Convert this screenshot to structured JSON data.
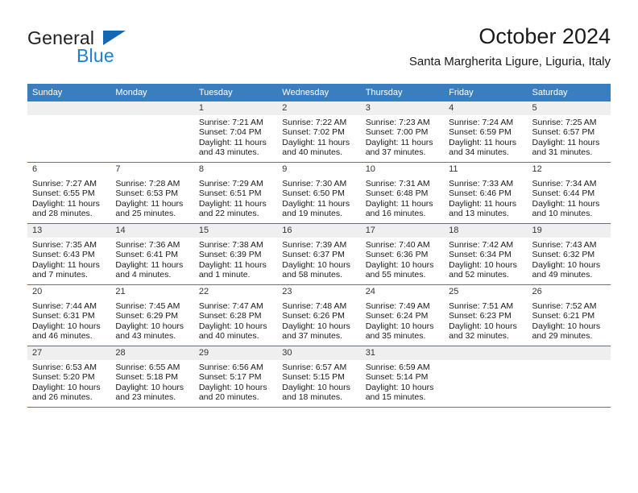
{
  "logo": {
    "text_primary": "General",
    "text_secondary": "Blue",
    "triangle_color": "#1468b3",
    "secondary_color": "#1f7fd4"
  },
  "header": {
    "title": "October 2024",
    "subtitle": "Santa Margherita Ligure, Liguria, Italy"
  },
  "theme": {
    "header_row_bg": "#3a7ebf",
    "header_row_text": "#ffffff",
    "daynum_bg": "#efefef",
    "grid_line": "#3a7ebf"
  },
  "weekdays": [
    "Sunday",
    "Monday",
    "Tuesday",
    "Wednesday",
    "Thursday",
    "Friday",
    "Saturday"
  ],
  "labels": {
    "sunrise_prefix": "Sunrise:",
    "sunset_prefix": "Sunset:",
    "daylight_prefix": "Daylight:"
  },
  "weeks": [
    [
      {
        "empty": true
      },
      {
        "empty": true
      },
      {
        "day": "1",
        "sunrise": "Sunrise: 7:21 AM",
        "sunset": "Sunset: 7:04 PM",
        "daylight_line1": "Daylight: 11 hours",
        "daylight_line2": "and 43 minutes."
      },
      {
        "day": "2",
        "sunrise": "Sunrise: 7:22 AM",
        "sunset": "Sunset: 7:02 PM",
        "daylight_line1": "Daylight: 11 hours",
        "daylight_line2": "and 40 minutes."
      },
      {
        "day": "3",
        "sunrise": "Sunrise: 7:23 AM",
        "sunset": "Sunset: 7:00 PM",
        "daylight_line1": "Daylight: 11 hours",
        "daylight_line2": "and 37 minutes."
      },
      {
        "day": "4",
        "sunrise": "Sunrise: 7:24 AM",
        "sunset": "Sunset: 6:59 PM",
        "daylight_line1": "Daylight: 11 hours",
        "daylight_line2": "and 34 minutes."
      },
      {
        "day": "5",
        "sunrise": "Sunrise: 7:25 AM",
        "sunset": "Sunset: 6:57 PM",
        "daylight_line1": "Daylight: 11 hours",
        "daylight_line2": "and 31 minutes."
      }
    ],
    [
      {
        "day": "6",
        "sunrise": "Sunrise: 7:27 AM",
        "sunset": "Sunset: 6:55 PM",
        "daylight_line1": "Daylight: 11 hours",
        "daylight_line2": "and 28 minutes."
      },
      {
        "day": "7",
        "sunrise": "Sunrise: 7:28 AM",
        "sunset": "Sunset: 6:53 PM",
        "daylight_line1": "Daylight: 11 hours",
        "daylight_line2": "and 25 minutes."
      },
      {
        "day": "8",
        "sunrise": "Sunrise: 7:29 AM",
        "sunset": "Sunset: 6:51 PM",
        "daylight_line1": "Daylight: 11 hours",
        "daylight_line2": "and 22 minutes."
      },
      {
        "day": "9",
        "sunrise": "Sunrise: 7:30 AM",
        "sunset": "Sunset: 6:50 PM",
        "daylight_line1": "Daylight: 11 hours",
        "daylight_line2": "and 19 minutes."
      },
      {
        "day": "10",
        "sunrise": "Sunrise: 7:31 AM",
        "sunset": "Sunset: 6:48 PM",
        "daylight_line1": "Daylight: 11 hours",
        "daylight_line2": "and 16 minutes."
      },
      {
        "day": "11",
        "sunrise": "Sunrise: 7:33 AM",
        "sunset": "Sunset: 6:46 PM",
        "daylight_line1": "Daylight: 11 hours",
        "daylight_line2": "and 13 minutes."
      },
      {
        "day": "12",
        "sunrise": "Sunrise: 7:34 AM",
        "sunset": "Sunset: 6:44 PM",
        "daylight_line1": "Daylight: 11 hours",
        "daylight_line2": "and 10 minutes."
      }
    ],
    [
      {
        "day": "13",
        "sunrise": "Sunrise: 7:35 AM",
        "sunset": "Sunset: 6:43 PM",
        "daylight_line1": "Daylight: 11 hours",
        "daylight_line2": "and 7 minutes."
      },
      {
        "day": "14",
        "sunrise": "Sunrise: 7:36 AM",
        "sunset": "Sunset: 6:41 PM",
        "daylight_line1": "Daylight: 11 hours",
        "daylight_line2": "and 4 minutes."
      },
      {
        "day": "15",
        "sunrise": "Sunrise: 7:38 AM",
        "sunset": "Sunset: 6:39 PM",
        "daylight_line1": "Daylight: 11 hours",
        "daylight_line2": "and 1 minute."
      },
      {
        "day": "16",
        "sunrise": "Sunrise: 7:39 AM",
        "sunset": "Sunset: 6:37 PM",
        "daylight_line1": "Daylight: 10 hours",
        "daylight_line2": "and 58 minutes."
      },
      {
        "day": "17",
        "sunrise": "Sunrise: 7:40 AM",
        "sunset": "Sunset: 6:36 PM",
        "daylight_line1": "Daylight: 10 hours",
        "daylight_line2": "and 55 minutes."
      },
      {
        "day": "18",
        "sunrise": "Sunrise: 7:42 AM",
        "sunset": "Sunset: 6:34 PM",
        "daylight_line1": "Daylight: 10 hours",
        "daylight_line2": "and 52 minutes."
      },
      {
        "day": "19",
        "sunrise": "Sunrise: 7:43 AM",
        "sunset": "Sunset: 6:32 PM",
        "daylight_line1": "Daylight: 10 hours",
        "daylight_line2": "and 49 minutes."
      }
    ],
    [
      {
        "day": "20",
        "sunrise": "Sunrise: 7:44 AM",
        "sunset": "Sunset: 6:31 PM",
        "daylight_line1": "Daylight: 10 hours",
        "daylight_line2": "and 46 minutes."
      },
      {
        "day": "21",
        "sunrise": "Sunrise: 7:45 AM",
        "sunset": "Sunset: 6:29 PM",
        "daylight_line1": "Daylight: 10 hours",
        "daylight_line2": "and 43 minutes."
      },
      {
        "day": "22",
        "sunrise": "Sunrise: 7:47 AM",
        "sunset": "Sunset: 6:28 PM",
        "daylight_line1": "Daylight: 10 hours",
        "daylight_line2": "and 40 minutes."
      },
      {
        "day": "23",
        "sunrise": "Sunrise: 7:48 AM",
        "sunset": "Sunset: 6:26 PM",
        "daylight_line1": "Daylight: 10 hours",
        "daylight_line2": "and 37 minutes."
      },
      {
        "day": "24",
        "sunrise": "Sunrise: 7:49 AM",
        "sunset": "Sunset: 6:24 PM",
        "daylight_line1": "Daylight: 10 hours",
        "daylight_line2": "and 35 minutes."
      },
      {
        "day": "25",
        "sunrise": "Sunrise: 7:51 AM",
        "sunset": "Sunset: 6:23 PM",
        "daylight_line1": "Daylight: 10 hours",
        "daylight_line2": "and 32 minutes."
      },
      {
        "day": "26",
        "sunrise": "Sunrise: 7:52 AM",
        "sunset": "Sunset: 6:21 PM",
        "daylight_line1": "Daylight: 10 hours",
        "daylight_line2": "and 29 minutes."
      }
    ],
    [
      {
        "day": "27",
        "sunrise": "Sunrise: 6:53 AM",
        "sunset": "Sunset: 5:20 PM",
        "daylight_line1": "Daylight: 10 hours",
        "daylight_line2": "and 26 minutes."
      },
      {
        "day": "28",
        "sunrise": "Sunrise: 6:55 AM",
        "sunset": "Sunset: 5:18 PM",
        "daylight_line1": "Daylight: 10 hours",
        "daylight_line2": "and 23 minutes."
      },
      {
        "day": "29",
        "sunrise": "Sunrise: 6:56 AM",
        "sunset": "Sunset: 5:17 PM",
        "daylight_line1": "Daylight: 10 hours",
        "daylight_line2": "and 20 minutes."
      },
      {
        "day": "30",
        "sunrise": "Sunrise: 6:57 AM",
        "sunset": "Sunset: 5:15 PM",
        "daylight_line1": "Daylight: 10 hours",
        "daylight_line2": "and 18 minutes."
      },
      {
        "day": "31",
        "sunrise": "Sunrise: 6:59 AM",
        "sunset": "Sunset: 5:14 PM",
        "daylight_line1": "Daylight: 10 hours",
        "daylight_line2": "and 15 minutes."
      },
      {
        "empty": true
      },
      {
        "empty": true
      }
    ]
  ]
}
